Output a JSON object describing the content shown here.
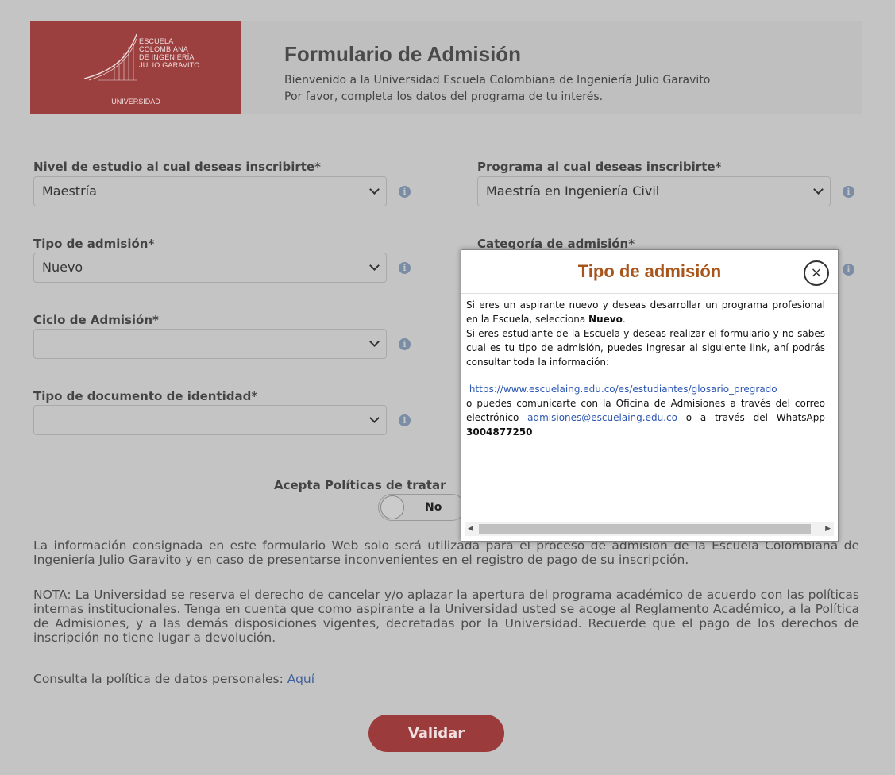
{
  "header": {
    "logo_lines": [
      "ESCUELA",
      "COLOMBIANA",
      "DE INGENIERÍA",
      "JULIO GARAVITO"
    ],
    "logo_sub": "UNIVERSIDAD",
    "title": "Formulario de Admisión",
    "subtitle1": "Bienvenido a la Universidad Escuela Colombiana de Ingeniería Julio Garavito",
    "subtitle2": "Por favor, completa los datos del programa de tu interés."
  },
  "form": {
    "nivel": {
      "label": "Nivel de estudio al cual deseas inscribirte*",
      "value": "Maestría"
    },
    "programa": {
      "label": "Programa al cual deseas inscribirte*",
      "value": "Maestría en Ingeniería Civil"
    },
    "tipo_admision": {
      "label": "Tipo de admisión*",
      "value": "Nuevo"
    },
    "categoria": {
      "label": "Categoría de admisión*",
      "value": ""
    },
    "ciclo": {
      "label": "Ciclo de Admisión*",
      "value": ""
    },
    "tipo_documento": {
      "label": "Tipo de documento de identidad*",
      "value": ""
    },
    "policy_label": "Acepta Políticas de tratar",
    "policy_toggle": "No"
  },
  "info_glyph": "i",
  "texts": {
    "info_para": "La información consignada en este formulario Web solo será utilizada para el proceso de admisión de la Escuela Colombiana de Ingeniería Julio Garavito y en caso de presentarse inconvenientes en el registro de pago de su inscripción.",
    "nota_para": "NOTA: La Universidad se reserva el derecho de cancelar y/o aplazar la apertura del programa académico de acuerdo con las políticas internas institucionales. Tenga en cuenta que como aspirante a la Universidad usted se acoge al Reglamento Académico, a la Política de Admisiones, y a las demás disposiciones vigentes, decretadas por la Universidad. Recuerde que el pago de los derechos de inscripción no tiene lugar a devolución.",
    "consulta_prefix": "Consulta la política de datos personales: ",
    "consulta_link": "Aquí",
    "validar": "Validar"
  },
  "modal": {
    "title": "Tipo de admisión",
    "close": "×",
    "p1_a": "Si eres un aspirante nuevo y deseas desarrollar un programa profesional en la Escuela, selecciona ",
    "p1_b": "Nuevo",
    "p1_c": ".",
    "p2": "Si eres estudiante de la Escuela y deseas realizar el formulario y no sabes cual es  tu tipo de admisión, puedes ingresar al siguiente link, ahí podrás consultar toda la información:",
    "link": "https://www.escuelaing.edu.co/es/estudiantes/glosario_pregrado",
    "p3_a": " o puedes comunicarte con la Oficina de Admisiones a través del correo electrónico ",
    "email": "admisiones@escuelaing.edu.co",
    "p3_b": " o a través del WhatsApp ",
    "whatsapp": "3004877250"
  },
  "colors": {
    "brand": "#9b3f3f",
    "modal_title": "#a8551c",
    "link": "#2b56b3",
    "info_icon": "#7a8da4"
  }
}
